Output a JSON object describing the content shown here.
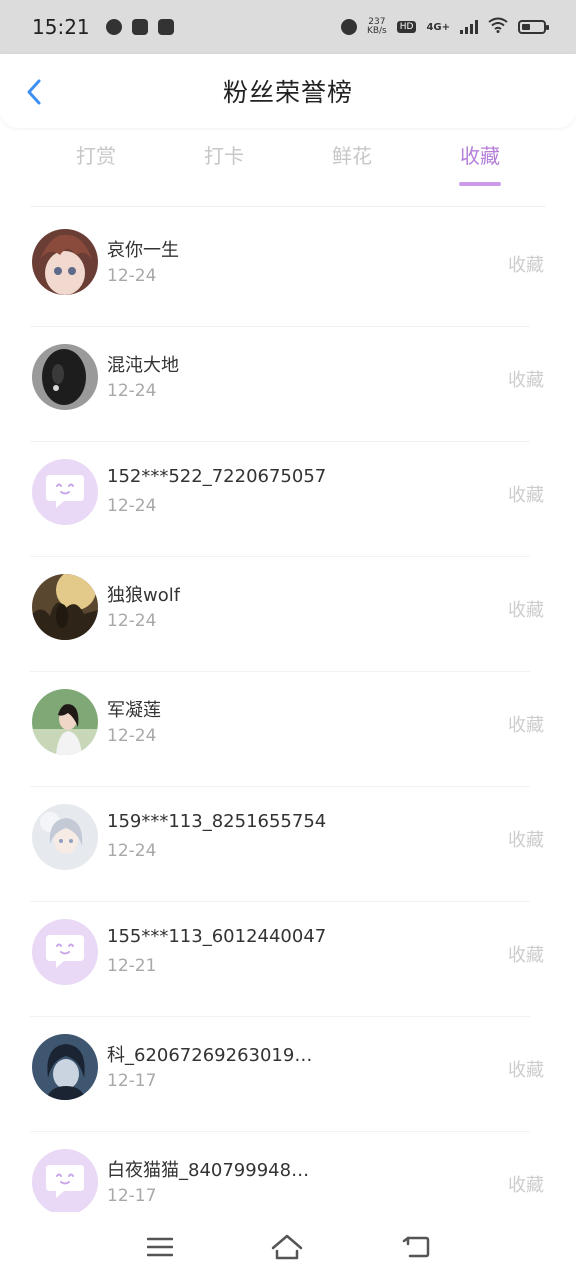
{
  "status_bar": {
    "time": "15:21",
    "net_speed_value": "237",
    "net_speed_unit": "KB/s",
    "hd_label": "HD",
    "signal_label": "4G+"
  },
  "header": {
    "title": "粉丝荣誉榜"
  },
  "tabs": [
    {
      "label": "打赏",
      "active": false
    },
    {
      "label": "打卡",
      "active": false
    },
    {
      "label": "鲜花",
      "active": false
    },
    {
      "label": "收藏",
      "active": true
    }
  ],
  "list": [
    {
      "name": "哀你一生",
      "date": "12-24",
      "action": "收藏",
      "avatar": "photo-anime-boy"
    },
    {
      "name": "混沌大地",
      "date": "12-24",
      "action": "收藏",
      "avatar": "photo-dark"
    },
    {
      "name": "152***522_7220675057",
      "date": "12-24",
      "action": "收藏",
      "avatar": "default-chat"
    },
    {
      "name": "独狼wolf",
      "date": "12-24",
      "action": "收藏",
      "avatar": "photo-forest"
    },
    {
      "name": "军凝莲",
      "date": "12-24",
      "action": "收藏",
      "avatar": "photo-girl"
    },
    {
      "name": "159***113_8251655754",
      "date": "12-24",
      "action": "收藏",
      "avatar": "photo-anime-girl"
    },
    {
      "name": "155***113_6012440047",
      "date": "12-21",
      "action": "收藏",
      "avatar": "default-chat"
    },
    {
      "name": "科_62067269263019…",
      "date": "12-17",
      "action": "收藏",
      "avatar": "photo-anime-dark"
    },
    {
      "name": "白夜猫猫_840799948…",
      "date": "12-17",
      "action": "收藏",
      "avatar": "default-chat"
    }
  ],
  "colors": {
    "accent": "#b57fd9",
    "underline": "#c99ae8",
    "default_avatar_bg": "#e9d9f6",
    "inactive_tab": "#c7c7c7",
    "back_arrow": "#3d8ff5"
  },
  "nav_icons": [
    "menu-icon",
    "home-icon",
    "back-icon"
  ]
}
